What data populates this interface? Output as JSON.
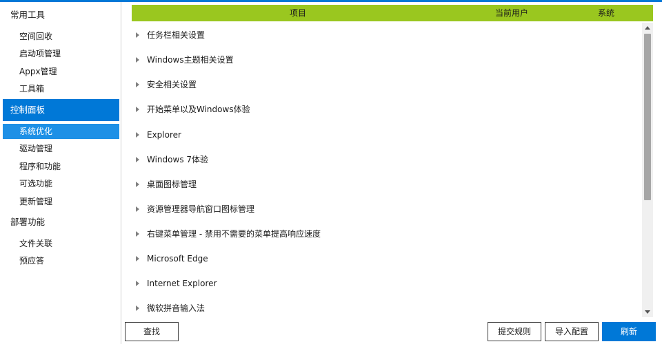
{
  "sidebar": {
    "groups": [
      {
        "label": "常用工具",
        "items": [
          "空间回收",
          "启动项管理",
          "Appx管理",
          "工具箱"
        ]
      },
      {
        "label": "控制面板",
        "items": [
          "系统优化",
          "驱动管理",
          "程序和功能",
          "可选功能",
          "更新管理"
        ]
      },
      {
        "label": "部署功能",
        "items": [
          "文件关联",
          "预应答"
        ]
      }
    ],
    "active_group": "控制面板",
    "active_item": "系统优化"
  },
  "table": {
    "columns": [
      "项目",
      "当前用户",
      "系统"
    ],
    "rows": [
      "任务栏相关设置",
      "Windows主题相关设置",
      "安全相关设置",
      "开始菜单以及Windows体验",
      "Explorer",
      "Windows 7体验",
      "桌面图标管理",
      "资源管理器导航窗口图标管理",
      "右键菜单管理 - 禁用不需要的菜单提高响应速度",
      "Microsoft Edge",
      "Internet Explorer",
      "微软拼音输入法"
    ]
  },
  "buttons": {
    "find": "查找",
    "submit_rules": "提交规则",
    "import_config": "导入配置",
    "refresh": "刷新"
  },
  "colors": {
    "accent": "#0078d7",
    "header_bg": "#9ac71f",
    "active_item": "#1e90e6"
  }
}
